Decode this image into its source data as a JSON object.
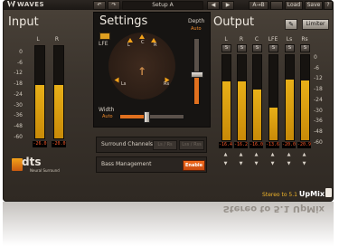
{
  "topbar": {
    "brand": "WAVES",
    "setup": "Setup A",
    "ab": "A→B",
    "prev": "◀",
    "next": "▶",
    "undo": "↶",
    "redo": "↷",
    "load": "Load",
    "save": "Save",
    "help": "?"
  },
  "input": {
    "title": "Input",
    "channels": [
      "L",
      "R"
    ],
    "levels": [
      0.58,
      0.58
    ],
    "peaks": [
      "-26.0",
      "-20.0"
    ],
    "scale": [
      "0",
      "-6",
      "-12",
      "-18",
      "-24",
      "-30",
      "-36",
      "-48",
      "-60"
    ]
  },
  "settings": {
    "title": "Settings",
    "depth_label": "Depth",
    "depth_auto": "Auto",
    "depth_level": 0.45,
    "lfe_label": "LFE",
    "speakers": [
      "L",
      "C",
      "R",
      "Ls",
      "Rs"
    ],
    "width_label": "Width",
    "width_auto": "Auto",
    "width_level": 0.42,
    "surround_label": "Surround Channels",
    "surround_opt1": "Ls / Rs",
    "surround_opt2": "Lss / Rss",
    "bass_label": "Bass Management",
    "enable_label": "Enable"
  },
  "output": {
    "title": "Output",
    "limiter": "Limiter",
    "tool_icon": "wrench-icon",
    "channels": [
      "L",
      "R",
      "C",
      "LFE",
      "Ls",
      "Rs"
    ],
    "solo": "S",
    "levels": [
      0.69,
      0.69,
      0.6,
      0.38,
      0.71,
      0.7
    ],
    "peaks": [
      "-16.4",
      "-16.2",
      "-16.0",
      "-13.6",
      "-20.0",
      "-20.9"
    ],
    "up": "▲",
    "down": "▼",
    "scale": [
      "0",
      "-6",
      "-12",
      "-18",
      "-24",
      "-30",
      "-36",
      "-48",
      "-60"
    ]
  },
  "branding": {
    "logo": "dts",
    "sub": "Neural Surround",
    "product_prefix": "Stereo to 5.1",
    "product_name": "UpMix"
  },
  "colors": {
    "meter": "#e0a418",
    "accent": "#e0701e",
    "peak_text": "#ff5a2a"
  }
}
